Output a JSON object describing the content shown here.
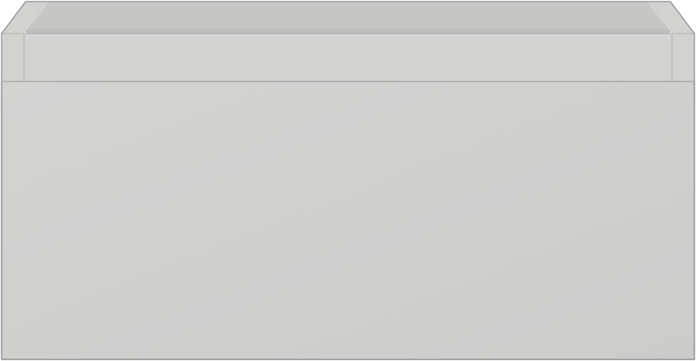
{
  "object": {
    "kind": "drawer-box",
    "colors": {
      "front_panel": "#cbcbca",
      "front_panel_highlight": "#d3d3d2",
      "top_rim": "#d2d2d1",
      "inner_back_wall": "#c6c6c5",
      "inner_floor_shadow": "#bdbdbc",
      "edge_line": "#aeaeae",
      "outline": "#9a9a9a",
      "background": "#ffffff"
    }
  }
}
